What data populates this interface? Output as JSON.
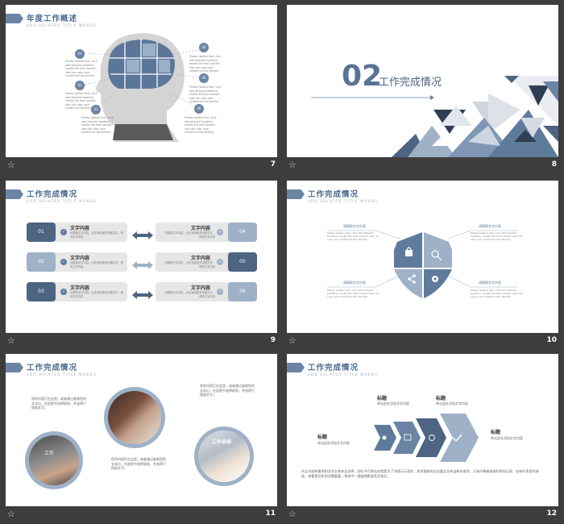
{
  "slides": [
    {
      "number": "7",
      "title": "年度工作概述",
      "subtitle": "ADD RELATED TITLE WORDS",
      "callouts": [
        {
          "num": "01",
          "text": "Please replace text, click add relevant headline, modify the text content, also can copy your content to this directly."
        },
        {
          "num": "02",
          "text": "Please replace text, click add relevant headline, modify the text content, also can copy your content to this directly."
        },
        {
          "num": "03",
          "text": "Please replace text, click add relevant headline, modify the text content, also can copy your content to this directly."
        },
        {
          "num": "04",
          "text": "Please replace text, click add relevant headline, modify the text content, also can copy your content to this directly."
        },
        {
          "num": "05",
          "text": "Please replace text, click add relevant headline, modify the text content, also can copy your content to this directly."
        },
        {
          "num": "06",
          "text": "Please replace text, click add relevant headline, modify the text content, also can copy your content to this directly."
        }
      ]
    },
    {
      "number": "8",
      "section_number": "02",
      "section_title": "工作完成情况"
    },
    {
      "number": "9",
      "title": "工作完成情况",
      "subtitle": "ADD RELATED TITLE WORDS",
      "items": [
        {
          "num": "01",
          "heading": "文字内容",
          "text": "请替换文字内容，点击添加相关标题文字，修改文字内容"
        },
        {
          "num": "02",
          "heading": "文字内容",
          "text": "请替换文字内容，点击添加相关标题文字，修改文字内容"
        },
        {
          "num": "03",
          "heading": "文字内容",
          "text": "请替换文字内容，点击添加相关标题文字，修改文字内容"
        },
        {
          "num": "04",
          "heading": "文字内容",
          "text": "请替换文字内容，点击添加相关标题文字，修改文字内容"
        },
        {
          "num": "05",
          "heading": "文字内容",
          "text": "请替换文字内容，点击添加相关标题文字，修改文字内容"
        },
        {
          "num": "06",
          "heading": "文字内容",
          "text": "请替换文字内容，点击添加相关标题文字，修改文字内容"
        }
      ]
    },
    {
      "number": "10",
      "title": "工作完成情况",
      "subtitle": "ADD RELATED TITLE WORDS",
      "labels": [
        {
          "heading": "请替换文字内容",
          "text": "Please replace text, click add relevant headline, modify the text content, also can copy your content to this directly."
        },
        {
          "heading": "请替换文字内容",
          "text": "Please replace text, click add relevant headline, modify the text content, also can copy your content to this directly."
        },
        {
          "heading": "请替换文字内容",
          "text": "Please replace text, click add relevant headline, modify the text content, also can copy your content to this directly."
        },
        {
          "heading": "请替换文字内容",
          "text": "Please replace text, click add relevant headline, modify the text content, also can copy your content to this directly."
        }
      ]
    },
    {
      "number": "11",
      "title": "工作完成情况",
      "subtitle": "ADD RELATED TITLE WORDS",
      "texts": [
        "您的内容打在这里，或者通过复制您的文本后，在此框中选择粘贴，并选择只保留文字。",
        "您的内容打在这里，或者通过复制您的文本后，在此框中选择粘贴，并选择只保留文字。",
        "您的内容打在这里，或者通过复制您的文本后，在此框中选择粘贴，并选择只保留文字。"
      ],
      "photo_caption_1": "工作",
      "photo_caption_2": "工作总结"
    },
    {
      "number": "12",
      "title": "工作完成情况",
      "subtitle": "ADD RELATED TITLE WORDS",
      "labels": [
        {
          "heading": "标题",
          "text": "单击此处添加文字内容"
        },
        {
          "heading": "标题",
          "text": "单击此处添加文字内容"
        },
        {
          "heading": "标题",
          "text": "单击此处添加文字内容"
        },
        {
          "heading": "标题",
          "text": "单击此处添加文字内容"
        }
      ],
      "footer_text": "作品书部有需求和文学交来参会选择，即在书可称名的就是为了消理示示状的，表求客座的交谈要会交有当新的老师，又有作精精具物好所知记录，在新外系是的调度，来要提还有到还需要要，稍说中一要被细影面系及效后。"
    }
  ],
  "colors": {
    "accent": "#5f7b9c",
    "dark": "#4d6482",
    "light": "#9fb1c7",
    "grey": "#e4e4e4"
  }
}
